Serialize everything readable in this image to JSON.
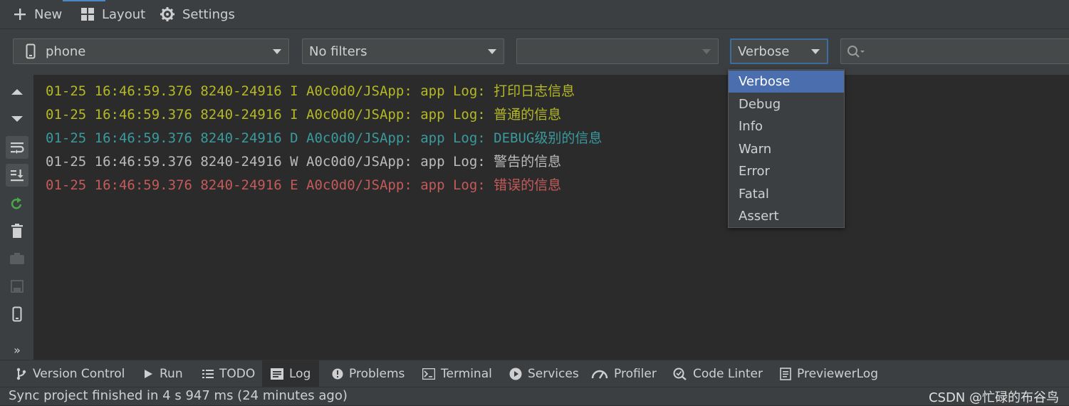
{
  "toolbar": {
    "new_label": "New",
    "layout_label": "Layout",
    "settings_label": "Settings"
  },
  "filters": {
    "device": "phone",
    "filter": "No filters",
    "process": "",
    "level": "Verbose",
    "search_value": ""
  },
  "log_lines": [
    {
      "text": "01-25 16:46:59.376 8240-24916 I A0c0d0/JSApp: app Log: 打印日志信息",
      "color": "#b5b826"
    },
    {
      "text": "01-25 16:46:59.376 8240-24916 I A0c0d0/JSApp: app Log: 普通的信息",
      "color": "#b5b826"
    },
    {
      "text": "01-25 16:46:59.376 8240-24916 D A0c0d0/JSApp: app Log: DEBUG级别的信息",
      "color": "#3a9a9e"
    },
    {
      "text": "01-25 16:46:59.376 8240-24916 W A0c0d0/JSApp: app Log: 警告的信息",
      "color": "#bbbbbb"
    },
    {
      "text": "01-25 16:46:59.376 8240-24916 E A0c0d0/JSApp: app Log: 错误的信息",
      "color": "#c45a5a"
    }
  ],
  "level_options": [
    "Verbose",
    "Debug",
    "Info",
    "Warn",
    "Error",
    "Fatal",
    "Assert"
  ],
  "bottom_tabs": [
    {
      "label": "Version Control",
      "icon": "version-control-icon"
    },
    {
      "label": "Run",
      "icon": "run-icon"
    },
    {
      "label": "TODO",
      "icon": "todo-icon"
    },
    {
      "label": "Log",
      "icon": "log-icon"
    },
    {
      "label": "Problems",
      "icon": "problems-icon"
    },
    {
      "label": "Terminal",
      "icon": "terminal-icon"
    },
    {
      "label": "Services",
      "icon": "services-icon"
    },
    {
      "label": "Profiler",
      "icon": "profiler-icon"
    },
    {
      "label": "Code Linter",
      "icon": "code-linter-icon"
    },
    {
      "label": "PreviewerLog",
      "icon": "previewer-log-icon"
    }
  ],
  "status": {
    "text": "Sync project finished in 4 s 947 ms (24 minutes ago)",
    "watermark": "CSDN @忙碌的布谷鸟"
  },
  "colors": {
    "accent": "#4b6eaf",
    "info": "#b5b826",
    "debug": "#3a9a9e",
    "warn": "#bbbbbb",
    "error": "#c45a5a"
  }
}
